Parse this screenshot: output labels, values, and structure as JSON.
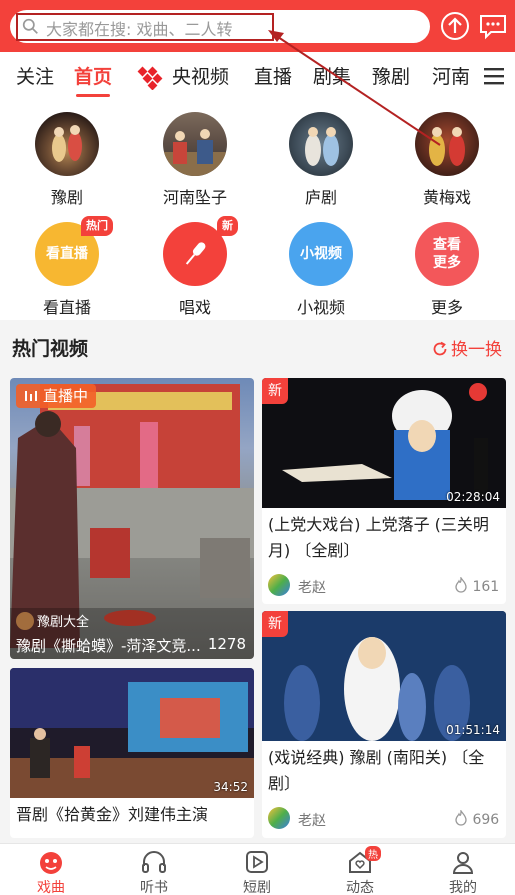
{
  "header": {
    "search_placeholder": "大家都在搜: 戏曲、二人转",
    "accent_color": "#f3413b"
  },
  "tabs": [
    {
      "label": "关注"
    },
    {
      "label": "首页",
      "active": true
    },
    {
      "label": "央视频"
    },
    {
      "label": "直播"
    },
    {
      "label": "剧集"
    },
    {
      "label": "豫剧"
    },
    {
      "label": "河南"
    }
  ],
  "categories": [
    {
      "label": "豫剧",
      "icon": "yuju-photo"
    },
    {
      "label": "河南坠子",
      "icon": "zhuizi-photo"
    },
    {
      "label": "庐剧",
      "icon": "luju-photo"
    },
    {
      "label": "黄梅戏",
      "icon": "huangmei-photo"
    },
    {
      "label": "看直播",
      "circle_text": "看直播",
      "badge": "热门",
      "color": "#f7b731"
    },
    {
      "label": "唱戏",
      "badge": "新",
      "color": "#f3413b",
      "icon": "microphone-icon"
    },
    {
      "label": "小视频",
      "circle_text": "小视频",
      "color": "#4aa4ee"
    },
    {
      "label": "更多",
      "circle_text": "查看\n更多",
      "color": "#f3575a"
    }
  ],
  "section": {
    "title": "热门视频",
    "refresh_label": "换一换"
  },
  "videos": {
    "left": [
      {
        "live_tag": "直播中",
        "channel": "豫剧大全",
        "title": "豫剧《撕蛤蟆》-菏泽文竞...",
        "count": "1278"
      },
      {
        "duration": "34:52",
        "title": "晋剧《拾黄金》刘建伟主演"
      }
    ],
    "right": [
      {
        "tag": "新",
        "duration": "02:28:04",
        "title": "(上党大戏台) 上党落子 (三关明月) 〔全剧〕",
        "author": "老赵",
        "likes": "161"
      },
      {
        "tag": "新",
        "duration": "01:51:14",
        "title": "(戏说经典) 豫剧 (南阳关) 〔全剧〕",
        "author": "老赵",
        "likes": "696"
      }
    ]
  },
  "bottom_nav": [
    {
      "label": "戏曲",
      "icon": "opera-face-icon",
      "active": true
    },
    {
      "label": "听书",
      "icon": "headphones-icon"
    },
    {
      "label": "短剧",
      "icon": "play-icon"
    },
    {
      "label": "动态",
      "icon": "heart-home-icon",
      "badge": "热"
    },
    {
      "label": "我的",
      "icon": "user-icon"
    }
  ]
}
